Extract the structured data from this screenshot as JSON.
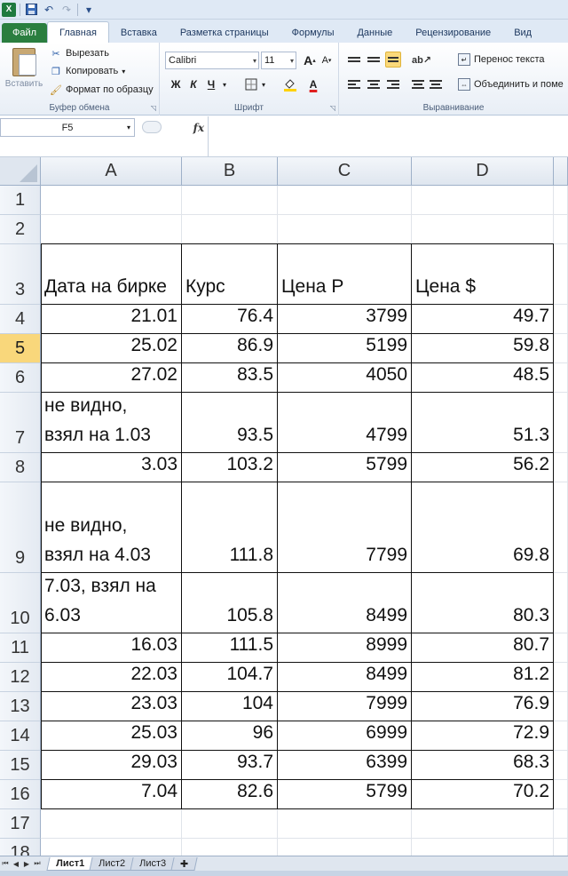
{
  "quick_access": {
    "app_icon": "excel-logo",
    "logo_letter": "X",
    "undo_glyph": "↶",
    "redo_glyph": "↷",
    "customize_glyph": "▾"
  },
  "tabs": [
    "Файл",
    "Главная",
    "Вставка",
    "Разметка страницы",
    "Формулы",
    "Данные",
    "Рецензирование",
    "Вид"
  ],
  "active_tab": "Главная",
  "ribbon": {
    "clipboard": {
      "paste_label": "Вставить",
      "cut_label": "Вырезать",
      "copy_label": "Копировать",
      "format_painter_label": "Формат по образцу",
      "group_label": "Буфер обмена"
    },
    "font": {
      "font_name": "Calibri",
      "font_size": "11",
      "grow_label": "A",
      "shrink_label": "A",
      "bold_label": "Ж",
      "italic_label": "К",
      "underline_label": "Ч",
      "font_color_label": "A",
      "group_label": "Шрифт"
    },
    "alignment": {
      "wrap_text_label": "Перенос текста",
      "merge_label": "Объединить и поме",
      "group_label": "Выравнивание"
    }
  },
  "formula_bar": {
    "name_box": "F5",
    "fx_label": "fx",
    "formula": ""
  },
  "columns": [
    "A",
    "B",
    "C",
    "D"
  ],
  "rows": [
    {
      "num": "1",
      "cells": []
    },
    {
      "num": "2",
      "cells": []
    },
    {
      "num": "3",
      "cells": [
        "Дата на бирке",
        "Курс",
        "Цена Р",
        "Цена $"
      ]
    },
    {
      "num": "4",
      "cells": [
        "21.01",
        "76.4",
        "3799",
        "49.7"
      ]
    },
    {
      "num": "5",
      "cells": [
        "25.02",
        "86.9",
        "5199",
        "59.8"
      ]
    },
    {
      "num": "6",
      "cells": [
        "27.02",
        "83.5",
        "4050",
        "48.5"
      ]
    },
    {
      "num": "7",
      "cells": [
        [
          "не видно,",
          "взял на 1.03"
        ],
        "93.5",
        "4799",
        "51.3"
      ]
    },
    {
      "num": "8",
      "cells": [
        "3.03",
        "103.2",
        "5799",
        "56.2"
      ]
    },
    {
      "num": "9",
      "cells": [
        [
          "не видно,",
          "взял на 4.03"
        ],
        "111.8",
        "7799",
        "69.8"
      ]
    },
    {
      "num": "10",
      "cells": [
        [
          "7.03, взял на",
          "6.03"
        ],
        "105.8",
        "8499",
        "80.3"
      ]
    },
    {
      "num": "11",
      "cells": [
        "16.03",
        "111.5",
        "8999",
        "80.7"
      ]
    },
    {
      "num": "12",
      "cells": [
        "22.03",
        "104.7",
        "8499",
        "81.2"
      ]
    },
    {
      "num": "13",
      "cells": [
        "23.03",
        "104",
        "7999",
        "76.9"
      ]
    },
    {
      "num": "14",
      "cells": [
        "25.03",
        "96",
        "6999",
        "72.9"
      ]
    },
    {
      "num": "15",
      "cells": [
        "29.03",
        "93.7",
        "6399",
        "68.3"
      ]
    },
    {
      "num": "16",
      "cells": [
        "7.04",
        "82.6",
        "5799",
        "70.2"
      ]
    },
    {
      "num": "17",
      "cells": []
    },
    {
      "num": "18",
      "cells": []
    }
  ],
  "selected_row": "5",
  "sheets": [
    "Лист1",
    "Лист2",
    "Лист3"
  ],
  "active_sheet": "Лист1",
  "colors": {
    "file_tab": "#2a7e3f",
    "selected_header": "#f9d77b",
    "ribbon_bg": "#dfe9f5"
  }
}
